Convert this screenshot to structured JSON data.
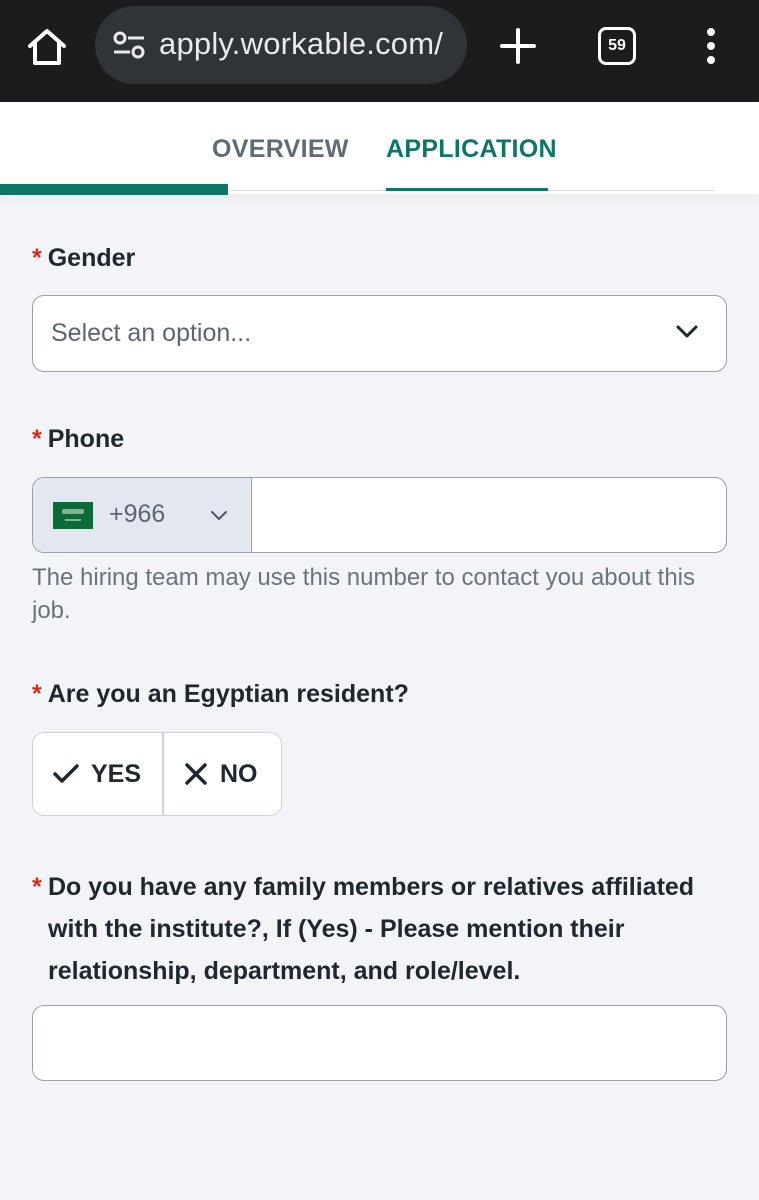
{
  "browser": {
    "url": "apply.workable.com/",
    "tab_count": "59"
  },
  "nav": {
    "tabs": [
      {
        "label": "OVERVIEW",
        "active": false
      },
      {
        "label": "APPLICATION",
        "active": true
      }
    ],
    "progress_fraction": 0.3,
    "accent_color": "#0e7567"
  },
  "form": {
    "required_marker": "*",
    "gender": {
      "label": "Gender",
      "placeholder": "Select an option..."
    },
    "phone": {
      "label": "Phone",
      "country_code": "+966",
      "country_flag": "saudi-arabia-flag",
      "value": "",
      "hint": "The hiring team may use this number to contact you about this job."
    },
    "egyptian_resident": {
      "label": "Are you an Egyptian resident?",
      "yes_label": "YES",
      "no_label": "NO"
    },
    "family_members": {
      "label": "Do you have any family members or relatives affiliated with the institute?, If (Yes) - Please mention their relationship, department, and role/level.",
      "value": ""
    }
  },
  "colors": {
    "required": "#c9311b",
    "accent": "#0e7567",
    "background": "#f3f4f8"
  }
}
